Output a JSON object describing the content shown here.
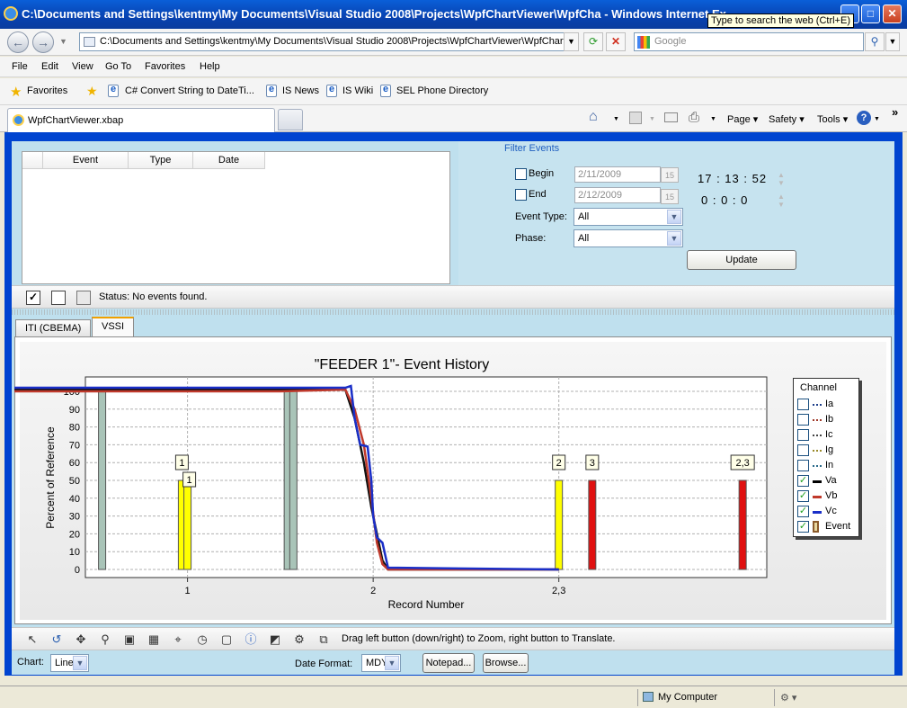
{
  "window": {
    "title": "C:\\Documents and Settings\\kentmy\\My Documents\\Visual Studio 2008\\Projects\\WpfChartViewer\\WpfCha - Windows Internet Ex",
    "tooltip": "Type to search the web (Ctrl+E)"
  },
  "address": {
    "url": "C:\\Documents and Settings\\kentmy\\My Documents\\Visual Studio 2008\\Projects\\WpfChartViewer\\WpfChart'",
    "search_placeholder": "Google"
  },
  "menu": [
    "File",
    "Edit",
    "View",
    "Go To",
    "Favorites",
    "Help"
  ],
  "favorites": {
    "label": "Favorites",
    "links": [
      "C# Convert String to DateTi...",
      "IS News",
      "IS Wiki",
      "SEL Phone Directory"
    ]
  },
  "tab": {
    "title": "WpfChartViewer.xbap"
  },
  "commands": {
    "page": "Page",
    "safety": "Safety",
    "tools": "Tools",
    "more": "»"
  },
  "events": {
    "columns": [
      "Event",
      "Type",
      "Date"
    ]
  },
  "filter": {
    "title": "Filter Events",
    "begin_label": "Begin",
    "begin_date": "2/11/2009",
    "begin_time": "17 : 13 : 52",
    "end_label": "End",
    "end_date": "2/12/2009",
    "end_time": "0 : 0 : 0",
    "cal_day": "15",
    "event_type_label": "Event Type:",
    "event_type_value": "All",
    "phase_label": "Phase:",
    "phase_value": "All",
    "update_label": "Update"
  },
  "status": {
    "text": "Status: No events found."
  },
  "chart_tabs": [
    "ITI (CBEMA)",
    "VSSI"
  ],
  "chart_data": {
    "type": "line",
    "title": "\"FEEDER 1\"- Event History",
    "xlabel": "Record Number",
    "ylabel": "Percent of Reference",
    "ylim": [
      0,
      100
    ],
    "yticks": [
      0,
      10,
      20,
      30,
      40,
      50,
      60,
      70,
      80,
      90,
      100
    ],
    "xticks": [
      "1",
      "2",
      "2,3"
    ],
    "grid": true,
    "legend_title": "Channel",
    "legend_placement": "right",
    "legend": [
      {
        "name": "Ia",
        "checked": false,
        "color": "#1e3f8a"
      },
      {
        "name": "Ib",
        "checked": false,
        "color": "#a03a2a"
      },
      {
        "name": "Ic",
        "checked": false,
        "color": "#444444"
      },
      {
        "name": "Ig",
        "checked": false,
        "color": "#9a8a2a"
      },
      {
        "name": "In",
        "checked": false,
        "color": "#2a6a8a"
      },
      {
        "name": "Va",
        "checked": true,
        "color": "#000000"
      },
      {
        "name": "Vb",
        "checked": true,
        "color": "#c0392b"
      },
      {
        "name": "Vc",
        "checked": true,
        "color": "#1a2fc8"
      },
      {
        "name": "Event",
        "checked": true,
        "color": "#8b5a2b"
      }
    ],
    "series": [
      {
        "name": "Va",
        "color": "#111111",
        "x": [
          0.0,
          0.3,
          0.6,
          0.9,
          1.2,
          1.5,
          1.85,
          1.9,
          1.95,
          1.99,
          2.02,
          2.05,
          2.08,
          3.0
        ],
        "values": [
          101,
          101,
          101,
          101,
          101,
          101,
          101,
          85,
          60,
          35,
          20,
          5,
          0,
          0
        ]
      },
      {
        "name": "Vb",
        "color": "#c0392b",
        "x": [
          0.0,
          0.3,
          0.6,
          0.9,
          1.2,
          1.5,
          1.85,
          1.9,
          1.95,
          1.99,
          2.02,
          2.05,
          2.08,
          3.0
        ],
        "values": [
          100,
          100,
          100,
          100,
          100,
          100,
          101,
          90,
          70,
          40,
          15,
          3,
          0,
          0
        ]
      },
      {
        "name": "Vc",
        "color": "#1a2fc8",
        "x": [
          0.0,
          0.3,
          0.6,
          0.9,
          1.2,
          1.5,
          1.85,
          1.88,
          1.9,
          1.93,
          1.97,
          1.99,
          2.0,
          2.02,
          2.05,
          2.08,
          3.0
        ],
        "values": [
          102,
          102,
          102,
          102,
          102,
          102,
          102,
          103,
          85,
          70,
          69,
          50,
          30,
          18,
          15,
          1,
          0
        ]
      }
    ],
    "event_bars": [
      {
        "x": -0.46,
        "value": 100,
        "color": "#a9c4b8",
        "label": ""
      },
      {
        "x": -0.03,
        "value": 50,
        "color": "#ffff00",
        "label": "1"
      },
      {
        "x": 0.0,
        "value": 50,
        "color": "#ffff00",
        "label": "1"
      },
      {
        "x": 0.54,
        "value": 100,
        "color": "#a9c4b8",
        "label": ""
      },
      {
        "x": 0.57,
        "value": 100,
        "color": "#a9c4b8",
        "label": ""
      },
      {
        "x": 2.0,
        "value": 50,
        "color": "#ffff00",
        "label": "2"
      },
      {
        "x": 2.18,
        "value": 50,
        "color": "#e01010",
        "label": "3"
      },
      {
        "x": 2.99,
        "value": 50,
        "color": "#e01010",
        "label": "2,3"
      }
    ]
  },
  "chart_tools_hint": "Drag left button (down/right) to Zoom, right button to Translate.",
  "bottom": {
    "chart_label": "Chart:",
    "chart_value": "Line",
    "date_format_label": "Date Format:",
    "date_format_value": "MDY",
    "notepad_label": "Notepad...",
    "browse_label": "Browse..."
  },
  "ie_status": {
    "zone": "My Computer"
  }
}
